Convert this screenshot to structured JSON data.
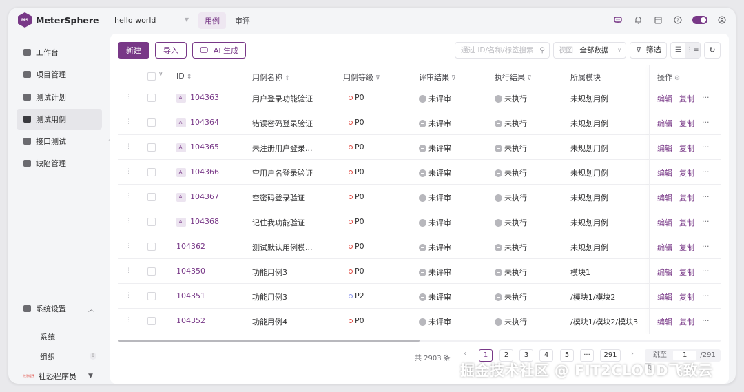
{
  "app": {
    "name": "MeterSphere",
    "logo_text": "MS"
  },
  "project": {
    "name": "hello world"
  },
  "topnav": [
    {
      "label": "用例",
      "active": true
    },
    {
      "label": "审评",
      "active": false
    }
  ],
  "sidebar": {
    "items": [
      {
        "label": "工作台"
      },
      {
        "label": "项目管理"
      },
      {
        "label": "测试计划"
      },
      {
        "label": "测试用例",
        "active": true
      },
      {
        "label": "接口测试"
      },
      {
        "label": "缺陷管理"
      }
    ],
    "settings": {
      "label": "系统设置",
      "children": [
        "系统",
        "组织"
      ],
      "org_badge": "8"
    },
    "user": {
      "label": "社恐程序员",
      "avatar_text": "社恐程序"
    }
  },
  "toolbar": {
    "new_label": "新建",
    "import_label": "导入",
    "ai_label": "AI 生成",
    "search_placeholder": "通过 ID/名称/标签搜索",
    "view_label": "视图",
    "view_value": "全部数据",
    "filter_label": "筛选"
  },
  "table": {
    "headers": {
      "id": "ID",
      "name": "用例名称",
      "level": "用例等级",
      "review": "评审结果",
      "exec": "执行结果",
      "module": "所属模块",
      "ops": "操作"
    },
    "rows": [
      {
        "ai": true,
        "ai_tag": "AI",
        "id": "104363",
        "name": "用户登录功能验证",
        "level": "P0",
        "review": "未评审",
        "exec": "未执行",
        "module": "未规划用例"
      },
      {
        "ai": true,
        "ai_tag": "AI",
        "id": "104364",
        "name": "错误密码登录验证",
        "level": "P0",
        "review": "未评审",
        "exec": "未执行",
        "module": "未规划用例"
      },
      {
        "ai": true,
        "ai_tag": "AI",
        "id": "104365",
        "name": "未注册用户登录...",
        "level": "P0",
        "review": "未评审",
        "exec": "未执行",
        "module": "未规划用例"
      },
      {
        "ai": true,
        "ai_tag": "AI",
        "id": "104366",
        "name": "空用户名登录验证",
        "level": "P0",
        "review": "未评审",
        "exec": "未执行",
        "module": "未规划用例"
      },
      {
        "ai": true,
        "ai_tag": "AI",
        "id": "104367",
        "name": "空密码登录验证",
        "level": "P0",
        "review": "未评审",
        "exec": "未执行",
        "module": "未规划用例"
      },
      {
        "ai": true,
        "ai_tag": "AI",
        "id": "104368",
        "name": "记住我功能验证",
        "level": "P0",
        "review": "未评审",
        "exec": "未执行",
        "module": "未规划用例"
      },
      {
        "ai": false,
        "id": "104362",
        "name": "测试默认用例模...",
        "level": "P0",
        "review": "未评审",
        "exec": "未执行",
        "module": "未规划用例"
      },
      {
        "ai": false,
        "id": "104350",
        "name": "功能用例3",
        "level": "P0",
        "review": "未评审",
        "exec": "未执行",
        "module": "模块1"
      },
      {
        "ai": false,
        "id": "104351",
        "name": "功能用例3",
        "level": "P2",
        "review": "未评审",
        "exec": "未执行",
        "module": "/模块1/模块2"
      },
      {
        "ai": false,
        "id": "104352",
        "name": "功能用例4",
        "level": "P0",
        "review": "未评审",
        "exec": "未执行",
        "module": "/模块1/模块2/模块3"
      }
    ],
    "op_edit": "编辑",
    "op_copy": "复制",
    "op_more": "···"
  },
  "pagination": {
    "total": "共 2903 条",
    "pages": [
      "1",
      "2",
      "3",
      "4",
      "5",
      "···",
      "291"
    ],
    "current": "1",
    "jump_label": "跳至",
    "jump_value": "1",
    "jump_total": "/291 页"
  },
  "watermark": "掘金技术社区 @ FIT2CLOUD飞致云",
  "colors": {
    "brand": "#783887",
    "p0": "#e0443b",
    "p2": "#8591ed"
  }
}
